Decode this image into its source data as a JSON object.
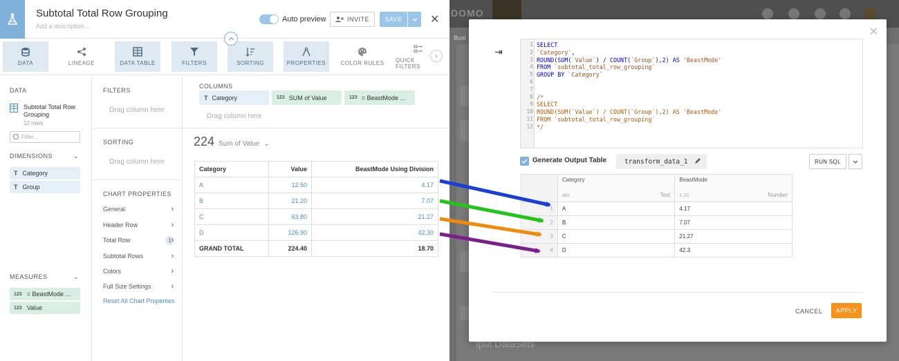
{
  "analyzer": {
    "title": "Subtotal Total Row Grouping",
    "description_placeholder": "Add a description...",
    "auto_preview_label": "Auto preview",
    "invite_label": "INVITE",
    "save_label": "SAVE"
  },
  "toolbar": {
    "items": [
      {
        "label": "DATA",
        "icon": "database-icon"
      },
      {
        "label": "LINEAGE",
        "icon": "lineage-icon"
      },
      {
        "label": "DATA TABLE",
        "icon": "table-icon"
      },
      {
        "label": "FILTERS",
        "icon": "filter-icon"
      },
      {
        "label": "SORTING",
        "icon": "sort-icon"
      },
      {
        "label": "PROPERTIES",
        "icon": "compass-icon"
      },
      {
        "label": "COLOR RULES",
        "icon": "palette-icon"
      },
      {
        "label": "QUICK FILTERS",
        "icon": "quick-filter-icon"
      }
    ]
  },
  "data_panel": {
    "section_label": "DATA",
    "dataset_name": "Subtotal Total Row Grouping",
    "dataset_rows": "12 rows",
    "filter_placeholder": "Filter...",
    "dimensions_label": "DIMENSIONS",
    "dimensions": [
      {
        "type": "T",
        "name": "Category"
      },
      {
        "type": "T",
        "name": "Group"
      }
    ],
    "measures_label": "MEASURES",
    "measures": [
      {
        "type": "123",
        "name": "= BeastMode ..."
      },
      {
        "type": "123",
        "name": "Value"
      }
    ]
  },
  "middle_panel": {
    "filters_label": "FILTERS",
    "filters_drag": "Drag column here",
    "sorting_label": "SORTING",
    "sorting_drag": "Drag column here",
    "chart_props_label": "CHART PROPERTIES",
    "chart_props": [
      "General",
      "Header Row",
      "Total Row",
      "Subtotal Rows",
      "Colors",
      "Full Size Settings"
    ],
    "total_row_badge": "1",
    "reset_label": "Reset All Chart Properties"
  },
  "columns_panel": {
    "label": "COLUMNS",
    "chips": [
      {
        "type": "T",
        "name": "Category"
      },
      {
        "type": "123",
        "name": "SUM of Value"
      },
      {
        "type": "123",
        "name": "= BeastMode ..."
      }
    ],
    "drag": "Drag column here",
    "summary_value": "224",
    "summary_label": "Sum of Value"
  },
  "result_table": {
    "headers": [
      "Category",
      "Value",
      "BeastMode Using Division"
    ],
    "rows": [
      [
        "A",
        "12.50",
        "4.17"
      ],
      [
        "B",
        "21.20",
        "7.07"
      ],
      [
        "C",
        "63.80",
        "21.27"
      ],
      [
        "D",
        "126.90",
        "42.30"
      ]
    ],
    "total": [
      "GRAND TOTAL",
      "224.40",
      "18.70"
    ]
  },
  "background": {
    "logo": "DOMO",
    "tab_text": "Busi",
    "output_text": "tput DataSets"
  },
  "modal": {
    "sql_lines": [
      "SELECT",
      "`Category`,",
      "ROUND(SUM(`Value`) / COUNT(`Group`),2) AS 'BeastMode'",
      "FROM `subtotal_total_row_grouping`",
      "GROUP BY `Category`",
      "",
      "",
      "/*",
      "SELECT",
      "ROUND(SUM(`Value`) / COUNT(`Group`),2) AS 'BeastMode'",
      "FROM `subtotal_total_row_grouping`",
      "*/"
    ],
    "generate_label": "Generate Output Table",
    "table_name": "transform_data_1",
    "run_sql_label": "RUN SQL",
    "output_headers": [
      {
        "name": "Category",
        "sub": "abc",
        "type": "Text"
      },
      {
        "name": "BeastMode",
        "sub": "1.23",
        "type": "Number"
      }
    ],
    "output_rows": [
      [
        "1",
        "A",
        "4.17"
      ],
      [
        "2",
        "B",
        "7.07"
      ],
      [
        "3",
        "C",
        "21.27"
      ],
      [
        "4",
        "D",
        "42.3"
      ]
    ],
    "cancel_label": "CANCEL",
    "apply_label": "APPLY"
  },
  "colors": {
    "arrow_a": "#1a3fd6",
    "arrow_b": "#22c51a",
    "arrow_c": "#f08a0c",
    "arrow_d": "#7b1f8c",
    "accent": "#7fb1db",
    "apply": "#f7931d"
  }
}
